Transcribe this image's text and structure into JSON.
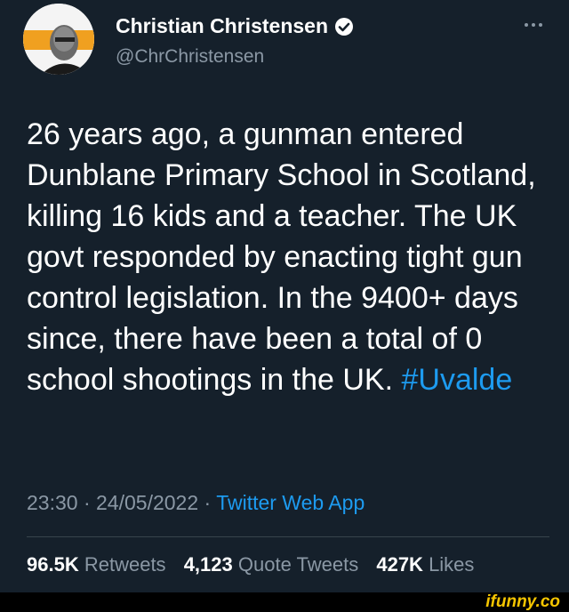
{
  "author": {
    "display_name": "Christian Christensen",
    "handle": "@ChrChristensen",
    "verified": true,
    "avatar_icon": "profile-photo"
  },
  "more_icon": "ellipsis-icon",
  "tweet": {
    "text": "26 years ago, a gunman entered Dunblane Primary School in Scotland, killing 16 kids and a teacher. The UK govt responded by enacting tight gun control legislation. In the 9400+ days since, there have been a total of 0 school shootings in the UK.",
    "hashtag": "#Uvalde"
  },
  "meta": {
    "time": "23:30",
    "separator": "·",
    "date": "24/05/2022",
    "source": "Twitter Web App"
  },
  "stats": {
    "retweets_count": "96.5K",
    "retweets_label": "Retweets",
    "quotes_count": "4,123",
    "quotes_label": "Quote Tweets",
    "likes_count": "427K",
    "likes_label": "Likes"
  },
  "watermark": "ifunny.co",
  "colors": {
    "background": "#15202b",
    "accent": "#1d9bf0",
    "muted": "#8b98a5",
    "watermark": "#f5c500"
  }
}
